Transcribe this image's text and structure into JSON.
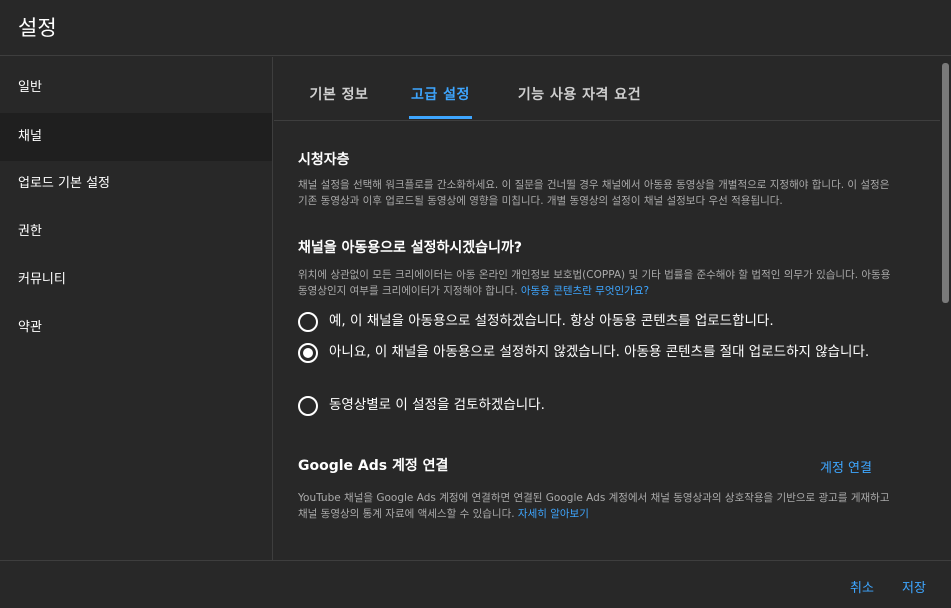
{
  "header": {
    "title": "설정"
  },
  "sidebar": {
    "items": [
      {
        "label": "일반"
      },
      {
        "label": "채널"
      },
      {
        "label": "업로드 기본 설정"
      },
      {
        "label": "권한"
      },
      {
        "label": "커뮤니티"
      },
      {
        "label": "약관"
      }
    ],
    "active_index": 1
  },
  "tabs": [
    {
      "label": "기본 정보"
    },
    {
      "label": "고급 설정"
    },
    {
      "label": "기능 사용 자격 요건"
    }
  ],
  "active_tab": 1,
  "audience": {
    "title": "시청자층",
    "description": "채널 설정을 선택해 워크플로를 간소화하세요. 이 질문을 건너뛸 경우 채널에서 아동용 동영상을 개별적으로 지정해야 합니다. 이 설정은 기존 동영상과 이후 업로드될 동영상에 영향을 미칩니다. 개별 동영상의 설정이 채널 설정보다 우선 적용됩니다.",
    "question": "채널을 아동용으로 설정하시겠습니까?",
    "question_desc": "위치에 상관없이 모든 크리에이터는 아동 온라인 개인정보 보호법(COPPA) 및 기타 법률을 준수해야 할 법적인 의무가 있습니다. 아동용 동영상인지 여부를 크리에이터가 지정해야 합니다. ",
    "question_link": "아동용 콘텐츠란 무엇인가요?",
    "options": [
      {
        "label": "예, 이 채널을 아동용으로 설정하겠습니다. 항상 아동용 콘텐츠를 업로드합니다."
      },
      {
        "label": "아니요, 이 채널을 아동용으로 설정하지 않겠습니다. 아동용 콘텐츠를 절대 업로드하지 않습니다."
      },
      {
        "label": "동영상별로 이 설정을 검토하겠습니다."
      }
    ],
    "selected_option": 1
  },
  "google_ads": {
    "title": "Google Ads 계정 연결",
    "connect_label": "계정 연결",
    "description": "YouTube 채널을 Google Ads 계정에 연결하면 연결된 Google Ads 계정에서 채널 동영상과의 상호작용을 기반으로 광고를 게재하고 채널 동영상의 통계 자료에 액세스할 수 있습니다. ",
    "learn_more": "자세히 알아보기"
  },
  "footer": {
    "cancel_label": "취소",
    "save_label": "저장"
  },
  "colors": {
    "background": "#282828",
    "accent": "#3ea6ff",
    "active_item": "#1f1f1f",
    "secondary_text": "#aaaaaa"
  }
}
